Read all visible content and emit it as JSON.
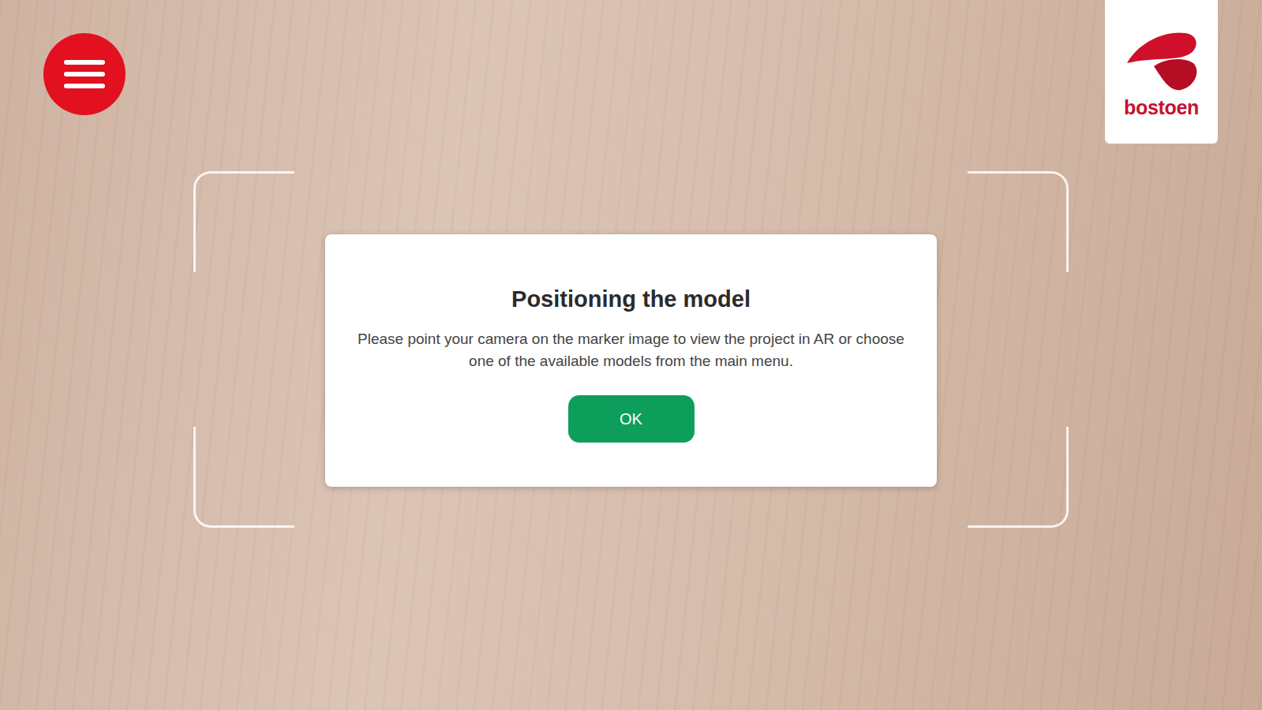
{
  "logo": {
    "text": "bostoen"
  },
  "dialog": {
    "title": "Positioning the model",
    "message": "Please point your camera on the marker image to view the project in AR or choose one of the available models from the main menu.",
    "buttons": [
      "OK"
    ]
  }
}
